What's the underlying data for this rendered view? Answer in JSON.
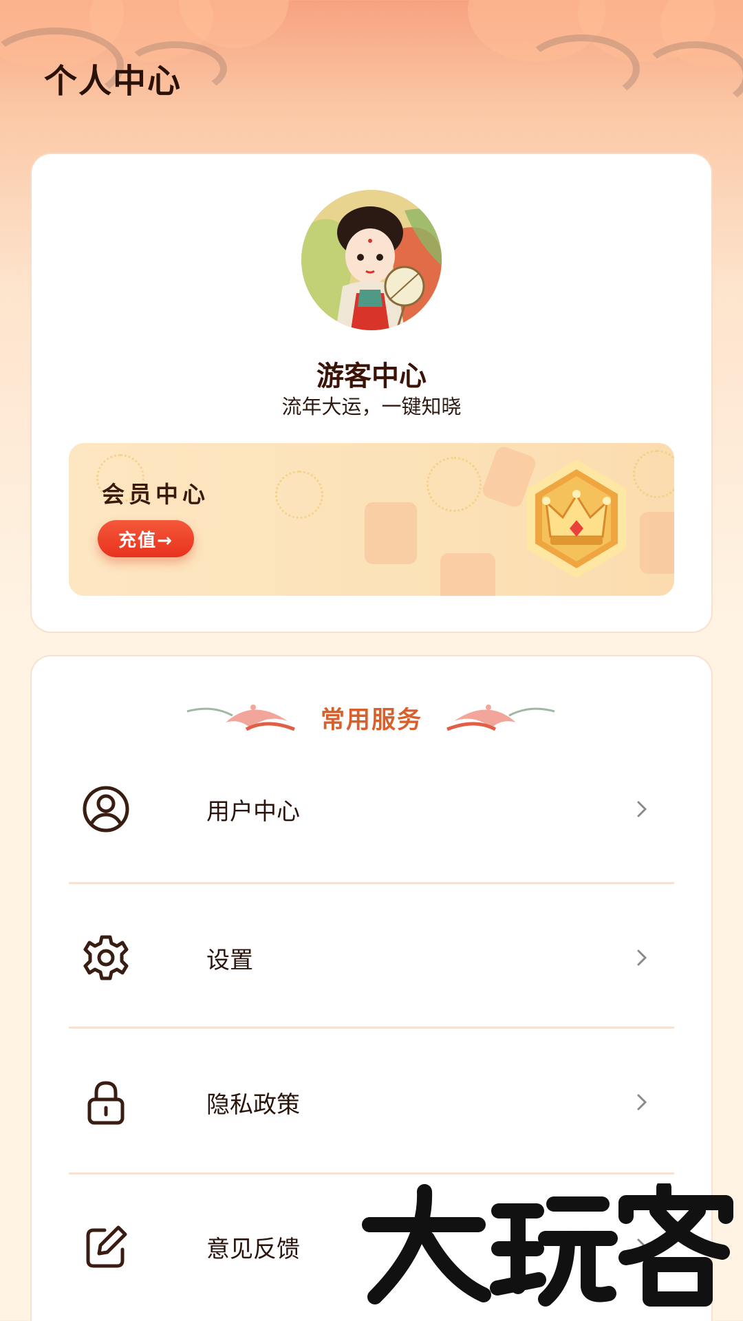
{
  "header": {
    "title": "个人中心"
  },
  "profile": {
    "name": "游客中心",
    "subtitle": "流年大运，一键知晓"
  },
  "member": {
    "title": "会员中心",
    "recharge_label": "充值→"
  },
  "services": {
    "title": "常用服务",
    "items": [
      {
        "label": "用户中心",
        "icon": "user-circle-icon"
      },
      {
        "label": "设置",
        "icon": "gear-icon"
      },
      {
        "label": "隐私政策",
        "icon": "lock-icon"
      },
      {
        "label": "意见反馈",
        "icon": "edit-icon"
      }
    ]
  },
  "watermark": {
    "text": "大玩客"
  },
  "colors": {
    "accent": "#d8602c",
    "recharge": "#e8321d",
    "text_dark": "#2a140c"
  }
}
